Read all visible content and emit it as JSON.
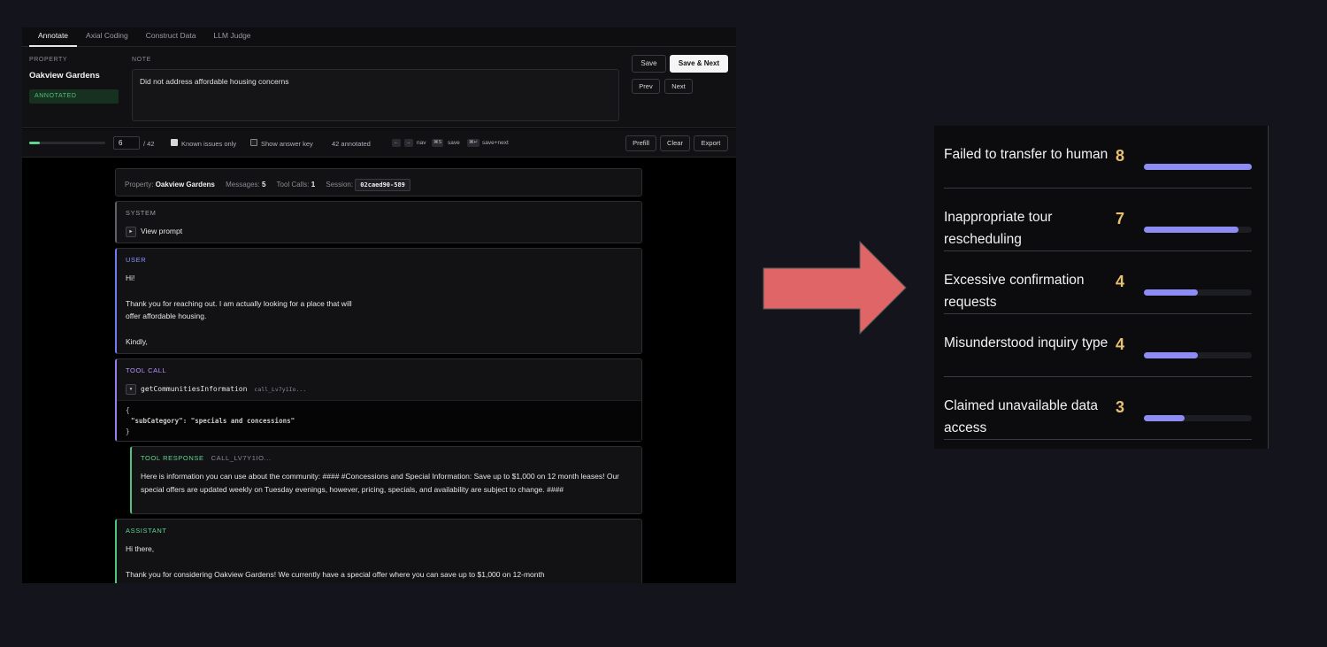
{
  "tabs": [
    "Annotate",
    "Axial Coding",
    "Construct Data",
    "LLM Judge"
  ],
  "property": {
    "label": "PROPERTY",
    "name": "Oakview Gardens",
    "status": "ANNOTATED"
  },
  "note": {
    "label": "NOTE",
    "value": "Did not address affordable housing concerns"
  },
  "actions": {
    "save": "Save",
    "save_next": "Save & Next",
    "prev": "Prev",
    "next": "Next"
  },
  "toolbar": {
    "progress_fraction": 0.14,
    "current": "6",
    "total": "/ 42",
    "known_issues": "Known issues only",
    "show_answer_key": "Show answer key",
    "annotated": "42 annotated",
    "key_prev": "←",
    "key_next": "→",
    "nav": "nav",
    "key_save": "⌘S",
    "save": "save",
    "key_savenext": "⌘↵",
    "save_next": "save+next",
    "prefill": "Prefill",
    "clear": "Clear",
    "export": "Export"
  },
  "meta": {
    "property_label": "Property:",
    "property_value": "Oakview Gardens",
    "messages_label": "Messages:",
    "messages_value": "5",
    "tool_calls_label": "Tool Calls:",
    "tool_calls_value": "1",
    "session_label": "Session:",
    "session_value": "02caed90-589"
  },
  "messages": {
    "system": {
      "role": "SYSTEM",
      "toggle": "►",
      "view": "View prompt"
    },
    "user": {
      "role": "USER",
      "line1": "Hi!",
      "line2": "Thank you for reaching out. I am actually looking for a place that will",
      "line3": "offer affordable housing.",
      "line4": "Kindly,"
    },
    "tool_call": {
      "role": "TOOL CALL",
      "toggle": "▾",
      "fn": "getCommunitiesInformation",
      "id": "call_Lv7y1Io...",
      "code1": "{",
      "code2": "\"subCategory\": \"specials and concessions\"",
      "code3": "}"
    },
    "tool_response": {
      "role": "TOOL RESPONSE",
      "id": "CALL_LV7Y1IO...",
      "text": "Here is information you can use about the community: #### #Concessions and Special Information: Save up to $1,000 on 12 month leases! Our special offers are updated weekly on Tuesday evenings, however, pricing, specials, and availability are subject to change. ####"
    },
    "assistant": {
      "role": "ASSISTANT",
      "line1": "Hi there,",
      "line2": "Thank you for considering Oakview Gardens! We currently have a special offer where you can save up to $1,000 on 12-month"
    }
  },
  "colors": {
    "arrow": "#e06566",
    "bar": "#8d8cf5",
    "count": "#e8c170",
    "progress": "#5fd48f"
  },
  "chart_data": {
    "type": "bar",
    "categories": [
      "Failed to transfer to human",
      "Inappropriate tour rescheduling",
      "Excessive confirmation requests",
      "Misunderstood inquiry type",
      "Claimed unavailable data access"
    ],
    "values": [
      8,
      7,
      4,
      4,
      3
    ],
    "xlim": [
      0,
      8
    ]
  }
}
